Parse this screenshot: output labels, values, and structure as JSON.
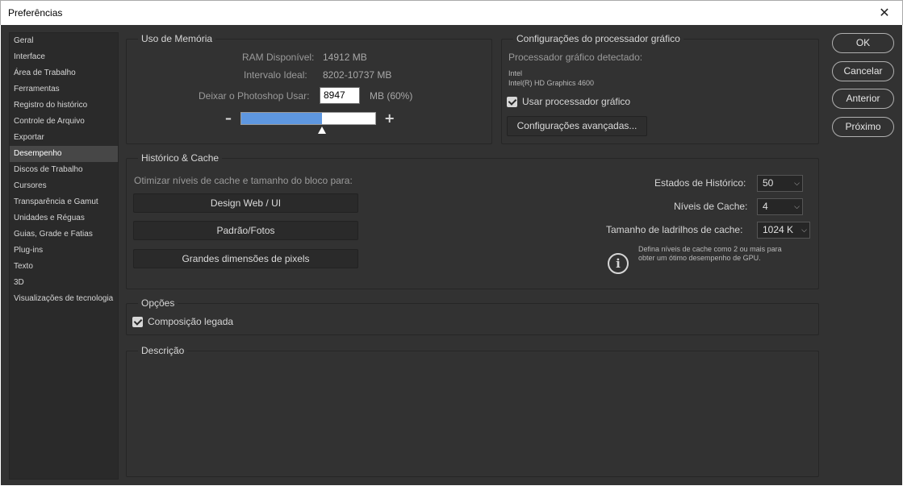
{
  "window": {
    "title": "Preferências",
    "close_glyph": "✕"
  },
  "sidebar": {
    "items": [
      {
        "label": "Geral"
      },
      {
        "label": "Interface"
      },
      {
        "label": "Área de Trabalho"
      },
      {
        "label": "Ferramentas"
      },
      {
        "label": "Registro do histórico"
      },
      {
        "label": "Controle de Arquivo"
      },
      {
        "label": "Exportar"
      },
      {
        "label": "Desempenho"
      },
      {
        "label": "Discos de Trabalho"
      },
      {
        "label": "Cursores"
      },
      {
        "label": "Transparência e Gamut"
      },
      {
        "label": "Unidades e Réguas"
      },
      {
        "label": "Guias, Grade e Fatias"
      },
      {
        "label": "Plug-ins"
      },
      {
        "label": "Texto"
      },
      {
        "label": "3D"
      },
      {
        "label": "Visualizações de tecnologia"
      }
    ],
    "active": "Desempenho"
  },
  "memory": {
    "title": "Uso de Memória",
    "ram_label": "RAM Disponível:",
    "ram_value": "14912 MB",
    "ideal_label": "Intervalo Ideal:",
    "ideal_value": "8202-10737 MB",
    "let_label": "Deixar o Photoshop Usar:",
    "let_value": "8947",
    "let_unit": "MB (60%)",
    "slider_percent": 60,
    "minus": "–",
    "plus": "+"
  },
  "gpu": {
    "title": "Configurações do processador gráfico",
    "detected_label": "Processador gráfico detectado:",
    "vendor": "Intel",
    "model": "Intel(R) HD Graphics 4600",
    "use_gpu_label": "Usar processador gráfico",
    "use_gpu_checked": true,
    "advanced_button": "Configurações avançadas..."
  },
  "cache": {
    "title": "Histórico & Cache",
    "optimize_label": "Otimizar níveis de cache e tamanho do bloco para:",
    "btn_web": "Design Web / UI",
    "btn_photo": "Padrão/Fotos",
    "btn_large": "Grandes dimensões de pixels",
    "history_label": "Estados de Histórico:",
    "history_value": "50",
    "levels_label": "Níveis de Cache:",
    "levels_value": "4",
    "tile_label": "Tamanho de ladrilhos de cache:",
    "tile_value": "1024 K",
    "hint": "Defina níveis de cache como 2 ou mais para obter um ótimo desempenho de GPU.",
    "info_glyph": "i"
  },
  "options": {
    "title": "Opções",
    "legacy_label": "Composição legada",
    "legacy_checked": true
  },
  "description": {
    "title": "Descrição"
  },
  "buttons": {
    "ok": "OK",
    "cancel": "Cancelar",
    "prev": "Anterior",
    "next": "Próximo"
  }
}
